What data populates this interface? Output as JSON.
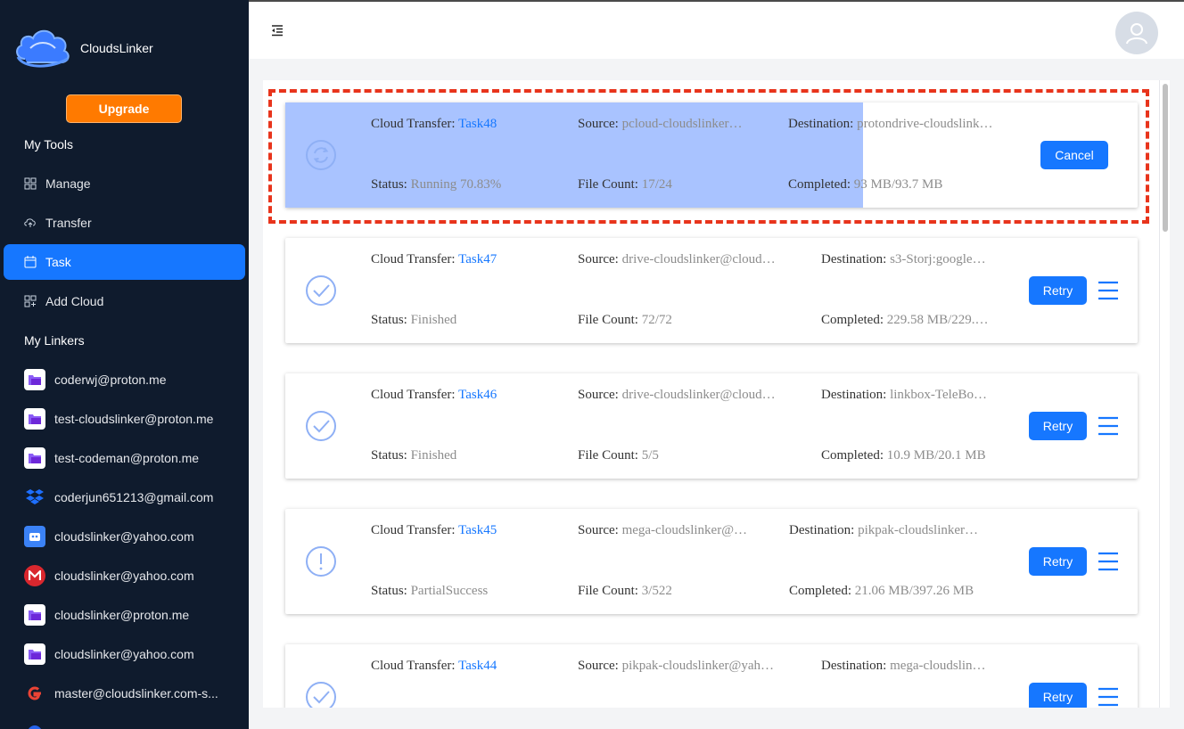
{
  "app": {
    "name": "CloudsLinker"
  },
  "sidebar": {
    "upgrade_label": "Upgrade",
    "tools_title": "My Tools",
    "tools": [
      {
        "label": "Manage",
        "icon": "grid-icon"
      },
      {
        "label": "Transfer",
        "icon": "cloud-transfer-icon"
      },
      {
        "label": "Task",
        "icon": "calendar-icon",
        "active": true
      },
      {
        "label": "Add Cloud",
        "icon": "add-cloud-icon"
      }
    ],
    "linkers_title": "My Linkers",
    "linkers": [
      {
        "label": "coderwj@proton.me",
        "icon": "proton-drive-icon"
      },
      {
        "label": "test-cloudslinker@proton.me",
        "icon": "proton-drive-icon"
      },
      {
        "label": "test-codeman@proton.me",
        "icon": "proton-drive-icon"
      },
      {
        "label": "coderjun651213@gmail.com",
        "icon": "dropbox-icon"
      },
      {
        "label": "cloudslinker@yahoo.com",
        "icon": "robot-icon"
      },
      {
        "label": "cloudslinker@yahoo.com",
        "icon": "mega-icon"
      },
      {
        "label": "cloudslinker@proton.me",
        "icon": "proton-drive-icon"
      },
      {
        "label": "cloudslinker@yahoo.com",
        "icon": "proton-drive-icon"
      },
      {
        "label": "master@cloudslinker.com-s...",
        "icon": "google-icon"
      }
    ]
  },
  "labels": {
    "cloud_transfer": "Cloud Transfer: ",
    "source": "Source: ",
    "destination": "Destination: ",
    "status": "Status: ",
    "file_count": "File Count: ",
    "completed": "Completed: "
  },
  "tasks": [
    {
      "name": "Task48",
      "source": "pcloud-cloudslinker…",
      "destination": "protondrive-cloudslink…",
      "status": "Running 70.83%",
      "file_count": "17/24",
      "completed": "93 MB/93.7 MB",
      "action": "Cancel",
      "state": "running",
      "progress": 0.678
    },
    {
      "name": "Task47",
      "source": "drive-cloudslinker@cloud…",
      "destination": "s3-Storj:google…",
      "status": "Finished",
      "file_count": "72/72",
      "completed": "229.58 MB/229.…",
      "action": "Retry",
      "state": "finished"
    },
    {
      "name": "Task46",
      "source": "drive-cloudslinker@cloud…",
      "destination": "linkbox-TeleBo…",
      "status": "Finished",
      "file_count": "5/5",
      "completed": "10.9 MB/20.1 MB",
      "action": "Retry",
      "state": "finished"
    },
    {
      "name": "Task45",
      "source": "mega-cloudslinker@…",
      "destination": "pikpak-cloudslinker…",
      "status": "PartialSuccess",
      "file_count": "3/522",
      "completed": "21.06 MB/397.26 MB",
      "action": "Retry",
      "state": "partial"
    },
    {
      "name": "Task44",
      "source": "pikpak-cloudslinker@yah…",
      "destination": "mega-cloudslin…",
      "status": "",
      "file_count": "",
      "completed": "",
      "action": "Retry",
      "state": "finished"
    }
  ],
  "colors": {
    "accent": "#1677ff",
    "sidebar_bg": "#0f1b2d",
    "upgrade": "#ff7a00",
    "progress": "#a9c3ff",
    "highlight": "#e8341c"
  }
}
